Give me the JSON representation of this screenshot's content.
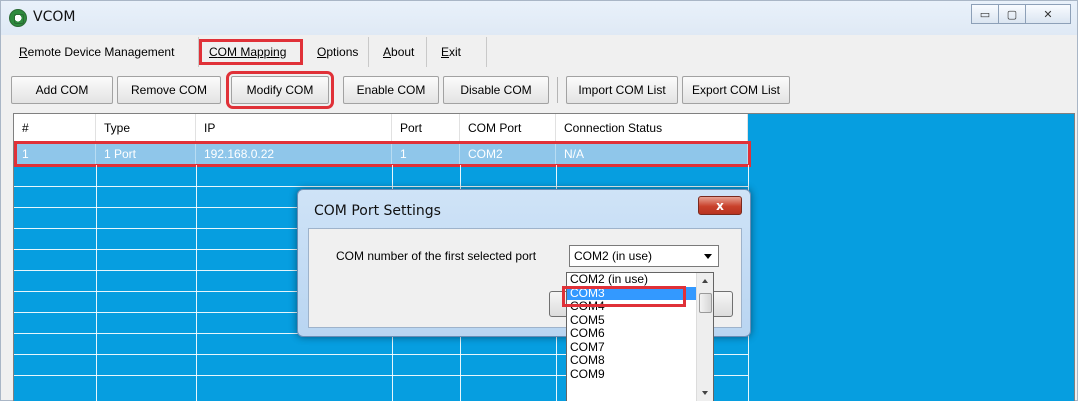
{
  "window": {
    "title": "VCOM",
    "minimize": "▭",
    "maximize": "▢",
    "close": "✕"
  },
  "menu": [
    {
      "label": "Remote Device Management",
      "underline": "R",
      "rest": "emote Device Management"
    },
    {
      "label": "COM Mapping",
      "underline": "C",
      "rest": "OM Mapping",
      "highlighted": true
    },
    {
      "label": "Options",
      "underline": "O",
      "rest": "ptions"
    },
    {
      "label": "About",
      "underline": "A",
      "rest": "bout"
    },
    {
      "label": "Exit",
      "underline": "E",
      "rest": "xit"
    }
  ],
  "toolbar": {
    "add_com": "Add COM",
    "remove_com": "Remove COM",
    "modify_com": "Modify COM",
    "enable_com": "Enable COM",
    "disable_com": "Disable COM",
    "import_com_list": "Import COM List",
    "export_com_list": "Export COM List"
  },
  "table": {
    "columns": [
      "#",
      "Type",
      "IP",
      "Port",
      "COM Port",
      "Connection Status"
    ],
    "rows": [
      [
        "1",
        "1 Port",
        "192.168.0.22",
        "1",
        "COM2",
        "N/A"
      ]
    ]
  },
  "dialog": {
    "title": "COM Port Settings",
    "close": "x",
    "label": "COM number of the first selected port",
    "selected_value": "COM2  (in use)",
    "options": [
      "COM2  (in use)",
      "COM3",
      "COM4",
      "COM5",
      "COM6",
      "COM7",
      "COM8",
      "COM9"
    ],
    "highlighted_option": "COM3"
  },
  "colors": {
    "grid_background": "#069ee0",
    "selection_row": "#8fc6ea",
    "highlight_box": "#e03138",
    "dropdown_selection": "#3399ff"
  }
}
